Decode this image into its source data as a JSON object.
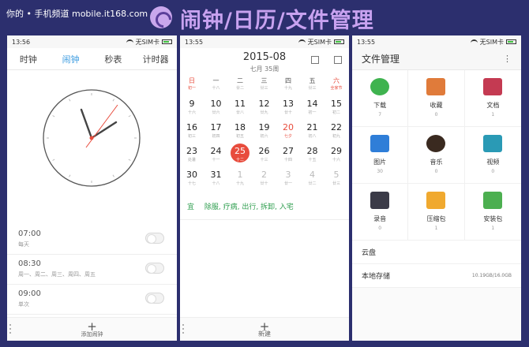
{
  "banner": {
    "watermark": "你的 • 手机频道 mobile.it168.com",
    "title": "闹钟/日历/文件管理"
  },
  "clock_app": {
    "status_time": "13:56",
    "status_sim": "无SIM卡",
    "tabs": [
      {
        "label": "时钟",
        "active": false
      },
      {
        "label": "闹钟",
        "active": true
      },
      {
        "label": "秒表",
        "active": false
      },
      {
        "label": "计时器",
        "active": false
      }
    ],
    "alarms": [
      {
        "time": "07:00",
        "repeat": "每天",
        "enabled": false
      },
      {
        "time": "08:30",
        "repeat": "周一、周二、周三、周四、周五",
        "enabled": false
      },
      {
        "time": "09:00",
        "repeat": "单次",
        "enabled": false
      }
    ],
    "add_label": "添加闹钟"
  },
  "calendar_app": {
    "status_time": "13:55",
    "status_sim": "无SIM卡",
    "month": "2015-08",
    "week": "七月 35周",
    "weekday_headers": [
      {
        "label": "日",
        "lunar": "初一",
        "red": true
      },
      {
        "label": "一",
        "lunar": "十八",
        "red": false
      },
      {
        "label": "二",
        "lunar": "廿二",
        "red": false
      },
      {
        "label": "三",
        "lunar": "廿三",
        "red": false
      },
      {
        "label": "四",
        "lunar": "十九",
        "red": false
      },
      {
        "label": "五",
        "lunar": "廿三",
        "red": false
      },
      {
        "label": "六",
        "lunar": "全家节",
        "red": true
      }
    ],
    "weeks": [
      [
        {
          "d": "9",
          "l": "十六"
        },
        {
          "d": "10",
          "l": "廿六"
        },
        {
          "d": "11",
          "l": "廿八"
        },
        {
          "d": "12",
          "l": "廿九"
        },
        {
          "d": "13",
          "l": "廿十"
        },
        {
          "d": "14",
          "l": "初一"
        },
        {
          "d": "15",
          "l": "初二"
        }
      ],
      [
        {
          "d": "16",
          "l": "初三"
        },
        {
          "d": "17",
          "l": "初四"
        },
        {
          "d": "18",
          "l": "初五"
        },
        {
          "d": "19",
          "l": "初六"
        },
        {
          "d": "20",
          "l": "七夕",
          "red": true
        },
        {
          "d": "21",
          "l": "初八"
        },
        {
          "d": "22",
          "l": "初九"
        }
      ],
      [
        {
          "d": "23",
          "l": "处暑"
        },
        {
          "d": "24",
          "l": "十一"
        },
        {
          "d": "25",
          "l": "十二",
          "today": true
        },
        {
          "d": "26",
          "l": "十三"
        },
        {
          "d": "27",
          "l": "十四"
        },
        {
          "d": "28",
          "l": "十五"
        },
        {
          "d": "29",
          "l": "十六"
        }
      ],
      [
        {
          "d": "30",
          "l": "十七"
        },
        {
          "d": "31",
          "l": "十八"
        },
        {
          "d": "1",
          "l": "十九",
          "muted": true
        },
        {
          "d": "2",
          "l": "廿十",
          "muted": true
        },
        {
          "d": "3",
          "l": "廿一",
          "muted": true
        },
        {
          "d": "4",
          "l": "廿二",
          "muted": true
        },
        {
          "d": "5",
          "l": "廿三",
          "muted": true
        }
      ]
    ],
    "yi_label": "宜",
    "yi_text": "除服, 疗病, 出行, 拆卸, 入宅",
    "new_label": "新建"
  },
  "files_app": {
    "status_time": "13:55",
    "status_sim": "无SIM卡",
    "title": "文件管理",
    "categories": [
      {
        "name": "下载",
        "count": "7",
        "icon": "download-icon",
        "color": "#3fb34f"
      },
      {
        "name": "收藏",
        "count": "0",
        "icon": "favorite-icon",
        "color": "#e07b3a"
      },
      {
        "name": "文档",
        "count": "1",
        "icon": "document-icon",
        "color": "#c43a52"
      },
      {
        "name": "图片",
        "count": "30",
        "icon": "picture-icon",
        "color": "#2f7ed8"
      },
      {
        "name": "音乐",
        "count": "0",
        "icon": "music-icon",
        "color": "#3a2a20"
      },
      {
        "name": "视频",
        "count": "0",
        "icon": "video-icon",
        "color": "#2a9ab5"
      },
      {
        "name": "录音",
        "count": "0",
        "icon": "recording-icon",
        "color": "#3b3b48"
      },
      {
        "name": "压缩包",
        "count": "1",
        "icon": "archive-icon",
        "color": "#f0a92f"
      },
      {
        "name": "安装包",
        "count": "1",
        "icon": "apk-icon",
        "color": "#4caf50"
      }
    ],
    "cloud_label": "云盘",
    "local_label": "本地存储",
    "local_usage": "10.19GB/16.0GB"
  }
}
